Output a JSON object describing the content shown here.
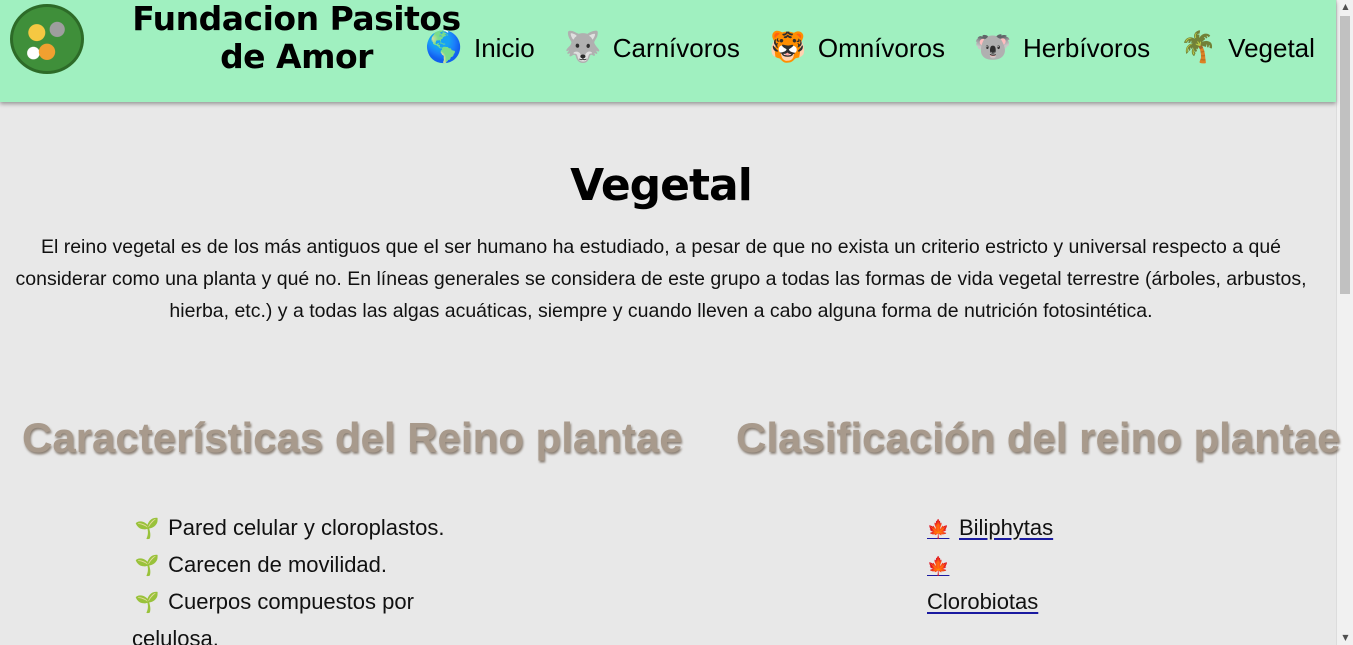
{
  "header": {
    "brand_line1": "Fundacion Pasitos",
    "brand_line2": "de Amor",
    "nav": [
      {
        "icon": "globe-icon",
        "glyph": "🌎",
        "label": "Inicio"
      },
      {
        "icon": "wolf-icon",
        "glyph": "🐺",
        "label": "Carnívoros"
      },
      {
        "icon": "tiger-icon",
        "glyph": "🐯",
        "label": "Omnívoros"
      },
      {
        "icon": "koala-icon",
        "glyph": "🐨",
        "label": "Herbívoros"
      },
      {
        "icon": "palm-tree-icon",
        "glyph": "🌴",
        "label": "Vegetal"
      }
    ]
  },
  "main": {
    "title": "Vegetal",
    "intro": "El reino vegetal es de los más antiguos que el ser humano ha estudiado, a pesar de que no exista un criterio estricto y universal respecto a qué considerar como una planta y qué no. En líneas generales se considera de este grupo a todas las formas de vida vegetal terrestre (árboles, arbustos, hierba, etc.) y a todas las algas acuáticas, siempre y cuando lleven a cabo alguna forma de nutrición fotosintética.",
    "characteristics": {
      "title": "Características del Reino plantae",
      "icon_glyph": "🌱",
      "items": [
        "Pared celular y cloroplastos.",
        " Carecen de movilidad.",
        " Cuerpos compuestos por celulosa."
      ]
    },
    "classification": {
      "title": "Clasificación del reino plantae",
      "icon_glyph": "🍁",
      "items": [
        "Biliphytas",
        "Clorobiotas"
      ]
    }
  },
  "colors": {
    "header_bg": "#a0f0c0",
    "page_bg": "#e8e8e8",
    "section_title": "#a89a8c"
  }
}
